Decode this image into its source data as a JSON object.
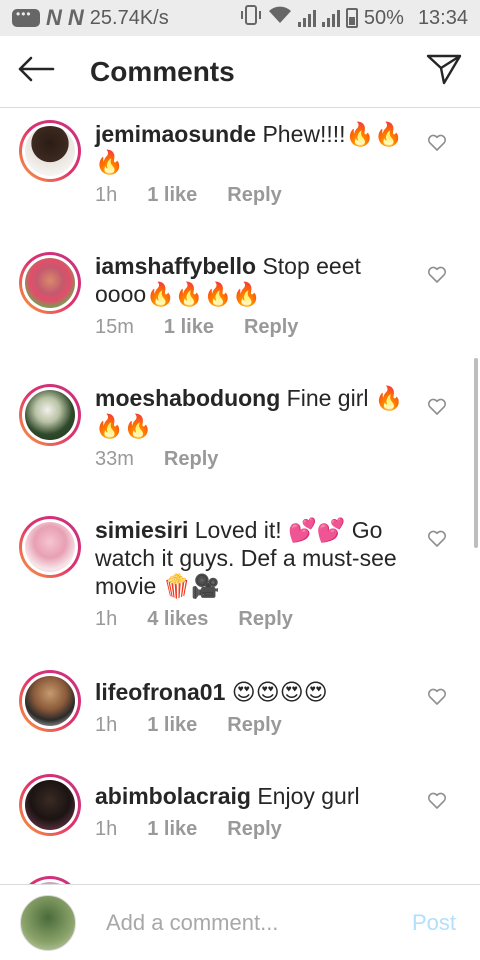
{
  "status_bar": {
    "speed": "25.74K/s",
    "battery": "50%",
    "time": "13:34"
  },
  "header": {
    "title": "Comments",
    "back_icon": "arrow-left-icon",
    "share_icon": "direct-share-icon"
  },
  "comments": [
    {
      "username": "jemimaosunde",
      "text": "Phew!!!!🔥🔥🔥",
      "time": "1h",
      "likes": "1 like",
      "reply": "Reply"
    },
    {
      "username": "iamshaffybello",
      "text": "Stop eeet oooo🔥🔥🔥🔥",
      "time": "15m",
      "likes": "1 like",
      "reply": "Reply"
    },
    {
      "username": "moeshaboduong",
      "text": "Fine girl 🔥🔥🔥",
      "time": "33m",
      "likes": "",
      "reply": "Reply"
    },
    {
      "username": "simiesiri",
      "text": "Loved it! 💕💕 Go watch it guys. Def a must-see movie 🍿🎥",
      "time": "1h",
      "likes": "4 likes",
      "reply": "Reply"
    },
    {
      "username": "lifeofrona01",
      "text": "😍😍😍😍",
      "time": "1h",
      "likes": "1 like",
      "reply": "Reply"
    },
    {
      "username": "abimbolacraig",
      "text": "Enjoy gurl",
      "time": "1h",
      "likes": "1 like",
      "reply": "Reply"
    }
  ],
  "footer": {
    "placeholder": "Add a comment...",
    "post_label": "Post"
  },
  "colors": {
    "post_disabled": "#b2dffc",
    "meta_gray": "#999999",
    "story_ring_start": "#f9a23b",
    "story_ring_end": "#c13584"
  }
}
